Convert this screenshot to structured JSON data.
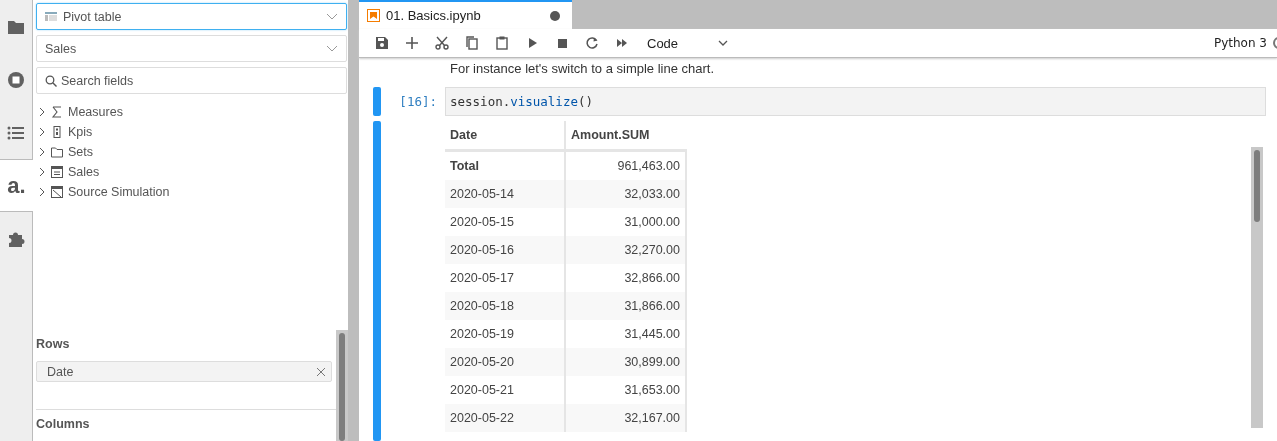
{
  "activity_bar": [
    {
      "kind": "folder",
      "selected": false
    },
    {
      "kind": "running",
      "selected": false
    },
    {
      "kind": "toc",
      "selected": false
    },
    {
      "kind": "logo",
      "text": "a.",
      "selected": true
    },
    {
      "kind": "extension",
      "selected": false
    }
  ],
  "sidebar": {
    "widget_select": {
      "value": "Pivot table",
      "focused": true
    },
    "cube_select": {
      "value": "Sales",
      "focused": false
    },
    "search": {
      "placeholder": "Search fields"
    },
    "tree": [
      {
        "label": "Measures",
        "kind": "measures",
        "expanded": false
      },
      {
        "label": "Kpis",
        "kind": "kpi",
        "expanded": false
      },
      {
        "label": "Sets",
        "kind": "folder",
        "expanded": false
      },
      {
        "label": "Sales",
        "kind": "table",
        "expanded": false
      },
      {
        "label": "Source Simulation",
        "kind": "simulation",
        "expanded": false
      }
    ],
    "rows": {
      "title": "Rows",
      "chips": [
        "Date"
      ]
    },
    "columns": {
      "title": "Columns"
    }
  },
  "tabs": [
    {
      "label": "01. Basics.ipynb",
      "selected": true,
      "modified": true
    }
  ],
  "toolbar": {
    "buttons": [
      {
        "kind": "save"
      },
      {
        "kind": "add"
      },
      {
        "kind": "cut"
      },
      {
        "kind": "copy"
      },
      {
        "kind": "paste"
      },
      {
        "kind": "run"
      },
      {
        "kind": "stop"
      },
      {
        "kind": "restart"
      },
      {
        "kind": "run-all"
      }
    ],
    "cell_type": "Code",
    "kernel": "Python 3"
  },
  "notebook": {
    "markdown": "For instance let's switch to a simple line chart.",
    "cell": {
      "prompt": "[16]:",
      "code": [
        {
          "kind": "name",
          "text": "session."
        },
        {
          "kind": "call",
          "text": "visualize"
        },
        {
          "kind": "name",
          "text": "()"
        }
      ]
    },
    "output": {
      "columns": [
        "Date",
        "Amount.SUM"
      ],
      "rows": [
        {
          "kind": "total",
          "cells": [
            "Total",
            "961,463.00"
          ]
        },
        {
          "kind": "row",
          "cells": [
            "2020-05-14",
            "32,033.00"
          ]
        },
        {
          "kind": "row",
          "cells": [
            "2020-05-15",
            "31,000.00"
          ]
        },
        {
          "kind": "row",
          "cells": [
            "2020-05-16",
            "32,270.00"
          ]
        },
        {
          "kind": "row",
          "cells": [
            "2020-05-17",
            "32,866.00"
          ]
        },
        {
          "kind": "row",
          "cells": [
            "2020-05-18",
            "31,866.00"
          ]
        },
        {
          "kind": "row",
          "cells": [
            "2020-05-19",
            "31,445.00"
          ]
        },
        {
          "kind": "row",
          "cells": [
            "2020-05-20",
            "30,899.00"
          ]
        },
        {
          "kind": "row",
          "cells": [
            "2020-05-21",
            "31,653.00"
          ]
        },
        {
          "kind": "row",
          "cells": [
            "2020-05-22",
            "32,167.00"
          ]
        }
      ]
    }
  }
}
